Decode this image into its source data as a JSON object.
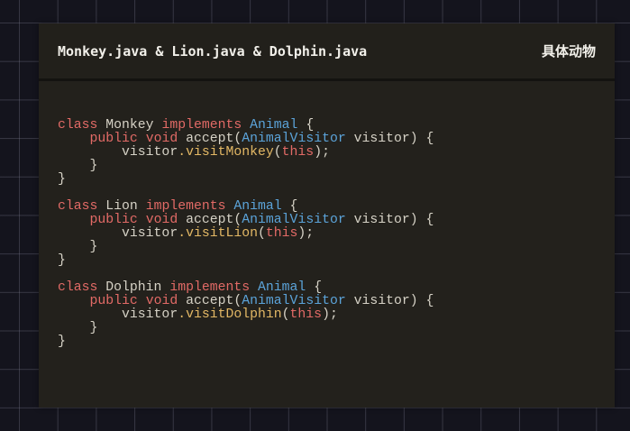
{
  "header": {
    "title": "Monkey.java & Lion.java & Dolphin.java",
    "label": "具体动物"
  },
  "colors": {
    "keyword": "#e26a66",
    "type": "#5ba3d9",
    "method": "#e3b865",
    "text": "#d6d2c6"
  },
  "code": [
    [
      [
        "class ",
        "kw"
      ],
      [
        "Monkey ",
        "tx"
      ],
      [
        "implements ",
        "kw"
      ],
      [
        "Animal ",
        "ty"
      ],
      [
        "{",
        "tx"
      ]
    ],
    [
      [
        "    ",
        "tx"
      ],
      [
        "public ",
        "kw"
      ],
      [
        "void ",
        "kw"
      ],
      [
        "accept(",
        "tx"
      ],
      [
        "AnimalVisitor ",
        "ty"
      ],
      [
        "visitor) {",
        "tx"
      ]
    ],
    [
      [
        "        visitor",
        "tx"
      ],
      [
        ".visitMonkey",
        "fn"
      ],
      [
        "(",
        "tx"
      ],
      [
        "this",
        "kw"
      ],
      [
        ");",
        "tx"
      ]
    ],
    [
      [
        "    }",
        "tx"
      ]
    ],
    [
      [
        "}",
        "tx"
      ]
    ],
    [],
    [
      [
        "class ",
        "kw"
      ],
      [
        "Lion ",
        "tx"
      ],
      [
        "implements ",
        "kw"
      ],
      [
        "Animal ",
        "ty"
      ],
      [
        "{",
        "tx"
      ]
    ],
    [
      [
        "    ",
        "tx"
      ],
      [
        "public ",
        "kw"
      ],
      [
        "void ",
        "kw"
      ],
      [
        "accept(",
        "tx"
      ],
      [
        "AnimalVisitor ",
        "ty"
      ],
      [
        "visitor) {",
        "tx"
      ]
    ],
    [
      [
        "        visitor",
        "tx"
      ],
      [
        ".visitLion",
        "fn"
      ],
      [
        "(",
        "tx"
      ],
      [
        "this",
        "kw"
      ],
      [
        ");",
        "tx"
      ]
    ],
    [
      [
        "    }",
        "tx"
      ]
    ],
    [
      [
        "}",
        "tx"
      ]
    ],
    [],
    [
      [
        "class ",
        "kw"
      ],
      [
        "Dolphin ",
        "tx"
      ],
      [
        "implements ",
        "kw"
      ],
      [
        "Animal ",
        "ty"
      ],
      [
        "{",
        "tx"
      ]
    ],
    [
      [
        "    ",
        "tx"
      ],
      [
        "public ",
        "kw"
      ],
      [
        "void ",
        "kw"
      ],
      [
        "accept(",
        "tx"
      ],
      [
        "AnimalVisitor ",
        "ty"
      ],
      [
        "visitor) {",
        "tx"
      ]
    ],
    [
      [
        "        visitor",
        "tx"
      ],
      [
        ".visitDolphin",
        "fn"
      ],
      [
        "(",
        "tx"
      ],
      [
        "this",
        "kw"
      ],
      [
        ");",
        "tx"
      ]
    ],
    [
      [
        "    }",
        "tx"
      ]
    ],
    [
      [
        "}",
        "tx"
      ]
    ]
  ]
}
